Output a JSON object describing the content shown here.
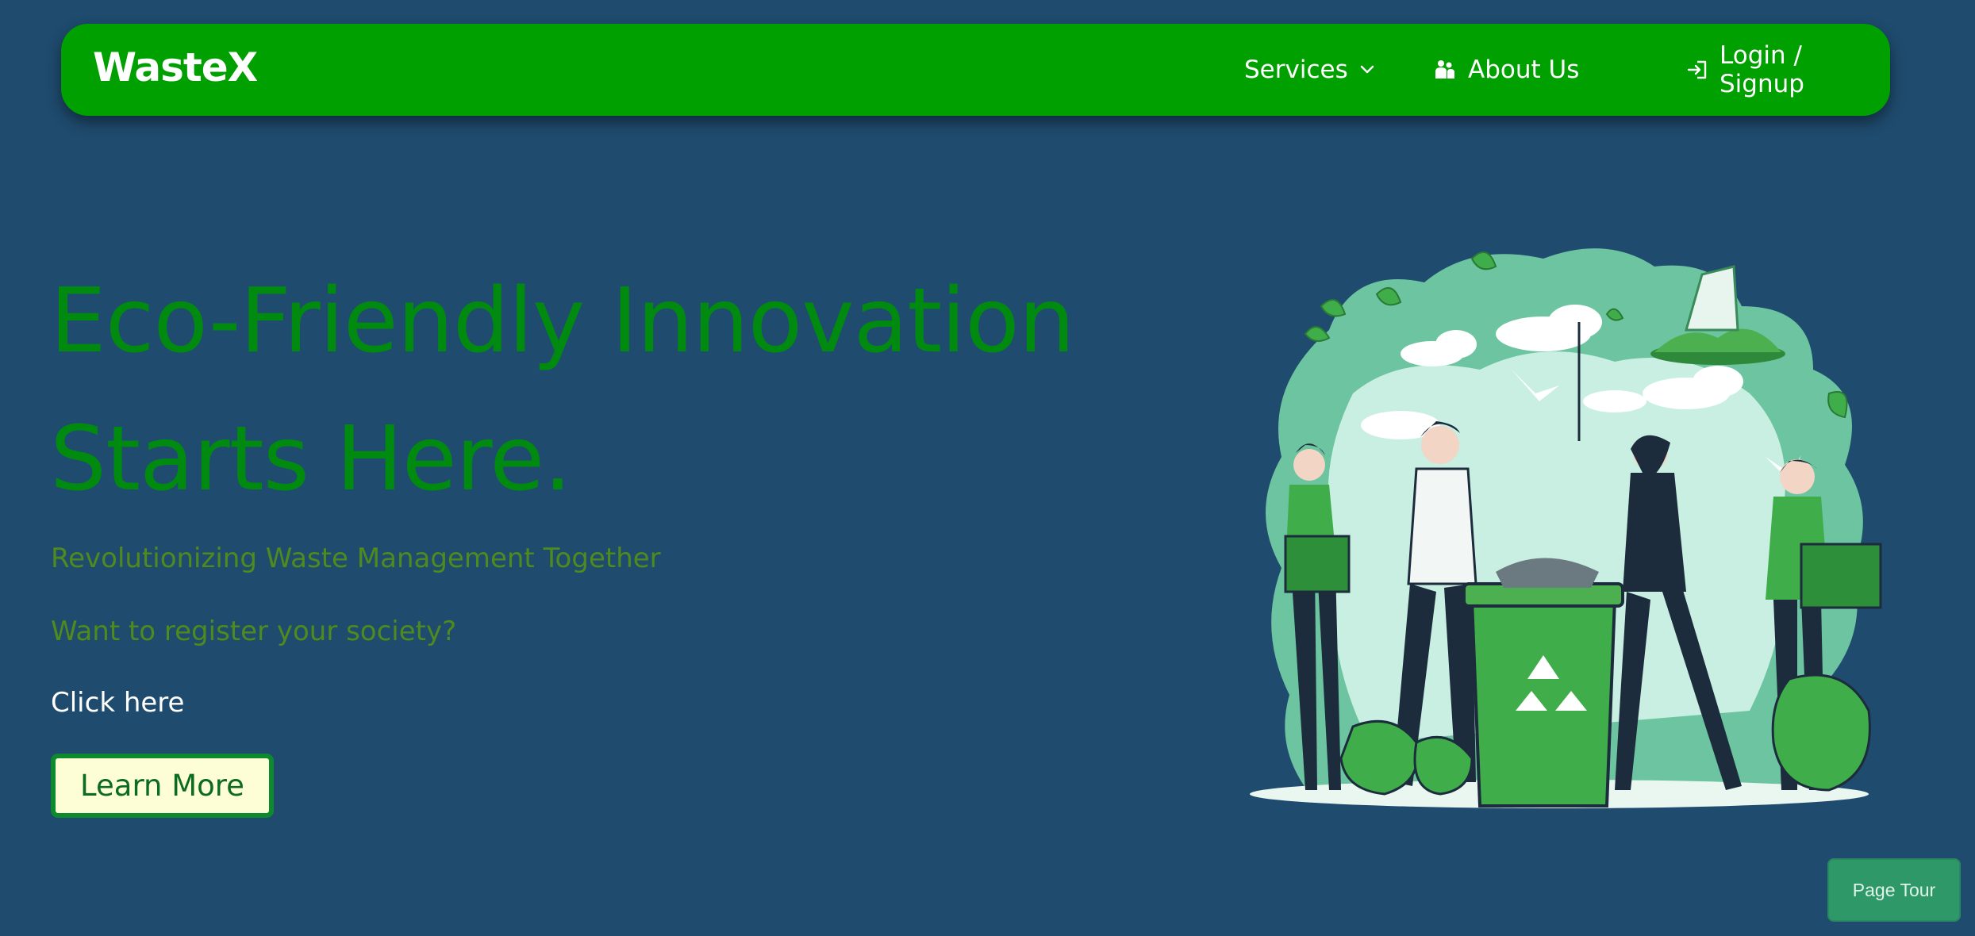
{
  "navbar": {
    "brand": "WasteX",
    "services_label": "Services",
    "about_label": "About Us",
    "login_label": "Login / Signup"
  },
  "hero": {
    "title_line1": "Eco-Friendly Innovation",
    "title_line2": "Starts Here.",
    "subtitle": "Revolutionizing Waste Management Together",
    "register_prompt": "Want to register your society?",
    "click_here": "Click here",
    "learn_more": "Learn More"
  },
  "page_tour_label": "Page Tour",
  "colors": {
    "background": "#1f4b6e",
    "navbar": "#00a000",
    "title_green": "#008a10",
    "subtitle_green": "#4f8a1e",
    "button_bg": "#fefed6",
    "button_border": "#0d8a2d",
    "tour_button": "#2f9868"
  },
  "icons": {
    "services": "chevron-down-icon",
    "about": "people-icon",
    "login": "login-icon"
  }
}
